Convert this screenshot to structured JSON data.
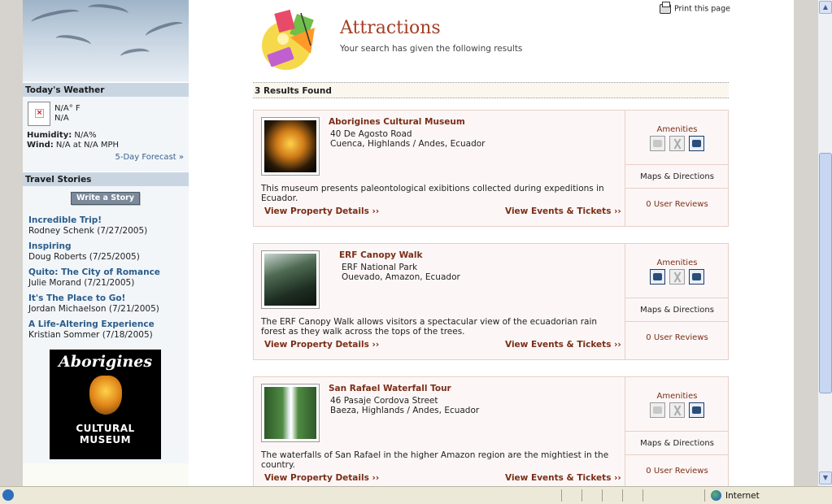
{
  "header": {
    "title": "Attractions",
    "subtitle": "Your search has given the following results",
    "print_label": "Print this page"
  },
  "weather": {
    "heading": "Today's Weather",
    "temp": "N/A° F",
    "condition": "N/A",
    "humidity_label": "Humidity:",
    "humidity_value": " N/A%",
    "wind_label": "Wind:",
    "wind_value": " N/A at N/A MPH",
    "forecast_link": "5-Day Forecast »"
  },
  "stories": {
    "heading": "Travel Stories",
    "write_button": "Write a Story",
    "items": [
      {
        "title": "Incredible Trip!",
        "author": "Rodney Schenk (7/27/2005)"
      },
      {
        "title": "Inspiring",
        "author": "Doug Roberts (7/25/2005)"
      },
      {
        "title": "Quito: The City of Romance",
        "author": "Julie Morand (7/21/2005)"
      },
      {
        "title": "It's The Place to Go!",
        "author": "Jordan Michaelson (7/21/2005)"
      },
      {
        "title": "A Life-Altering Experience",
        "author": "Kristian Sommer (7/18/2005)"
      }
    ]
  },
  "ad": {
    "line1": "Aborigines",
    "line2": "CULTURAL",
    "line3": "MUSEUM"
  },
  "results": {
    "count_label": "3 Results Found",
    "items": [
      {
        "name": "Aborigines Cultural Museum",
        "address1": "40 De Agosto Road",
        "address2": "Cuenca, Highlands / Andes, Ecuador",
        "description": "This museum presents paleontological exibitions collected during expeditions in Ecuador.",
        "details_link": "View Property Details ››",
        "events_link": "View Events & Tickets ››",
        "amenities_label": "Amenities",
        "maps_label": "Maps & Directions",
        "reviews_label": "0 User Reviews"
      },
      {
        "name": "ERF Canopy Walk",
        "address1": "ERF National Park",
        "address2": "Ouevado, Amazon, Ecuador",
        "description": "The ERF Canopy Walk allows visitors a spectacular view of the ecuadorian rain forest as they walk across the tops of the trees.",
        "details_link": "View Property Details ››",
        "events_link": "View Events & Tickets ››",
        "amenities_label": "Amenities",
        "maps_label": "Maps & Directions",
        "reviews_label": "0 User Reviews"
      },
      {
        "name": "San Rafael Waterfall Tour",
        "address1": "46 Pasaje Cordova Street",
        "address2": "Baeza, Highlands / Andes, Ecuador",
        "description": "The waterfalls of San Rafael in the higher Amazon region are the mightiest in the country.",
        "details_link": "View Property Details ››",
        "events_link": "View Events & Tickets ››",
        "amenities_label": "Amenities",
        "maps_label": "Maps & Directions",
        "reviews_label": "0 User Reviews"
      }
    ]
  },
  "statusbar": {
    "zone": "Internet"
  }
}
